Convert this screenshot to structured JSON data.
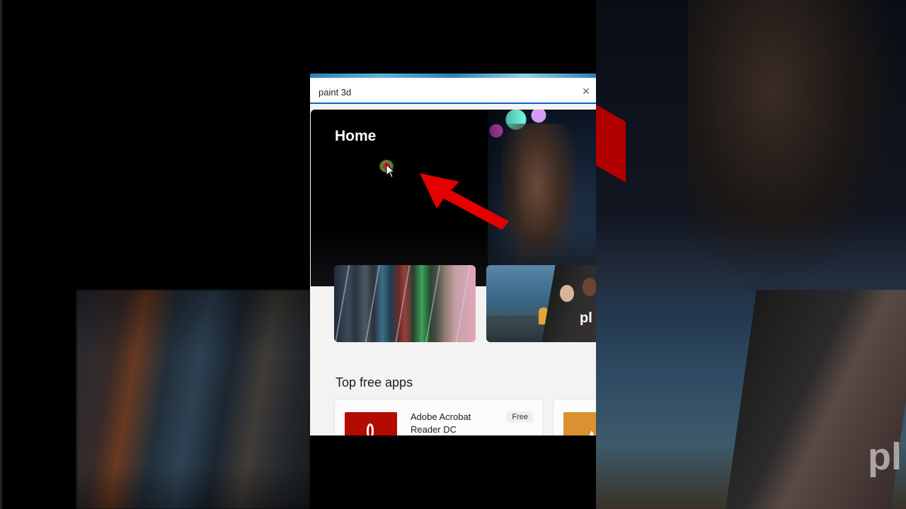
{
  "search": {
    "value": "paint 3d",
    "clear_icon": "close-icon"
  },
  "hero": {
    "title": "Home"
  },
  "top_free_apps": {
    "title": "Top free apps",
    "apps": [
      {
        "name": "Adobe Acrobat Reader DC",
        "price": "Free",
        "icon": "adobe-acrobat-icon",
        "icon_color": "#b30b00"
      }
    ]
  },
  "backdrop": {
    "right_logo_text": "pl"
  },
  "colors": {
    "search_accent": "#0b66c2",
    "annotation_arrow": "#e50000"
  }
}
